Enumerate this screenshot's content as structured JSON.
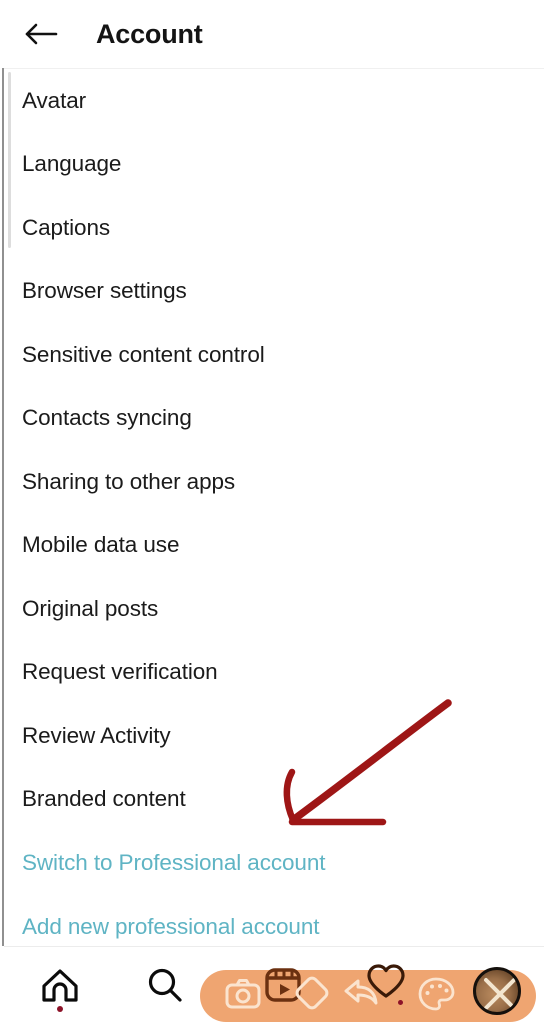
{
  "header": {
    "title": "Account",
    "back_icon": "arrow-left-icon"
  },
  "settings_list": {
    "items": [
      {
        "label": "Avatar",
        "type": "default"
      },
      {
        "label": "Language",
        "type": "default"
      },
      {
        "label": "Captions",
        "type": "default"
      },
      {
        "label": "Browser settings",
        "type": "default"
      },
      {
        "label": "Sensitive content control",
        "type": "default"
      },
      {
        "label": "Contacts syncing",
        "type": "default"
      },
      {
        "label": "Sharing to other apps",
        "type": "default"
      },
      {
        "label": "Mobile data use",
        "type": "default"
      },
      {
        "label": "Original posts",
        "type": "default"
      },
      {
        "label": "Request verification",
        "type": "default"
      },
      {
        "label": "Review Activity",
        "type": "default"
      },
      {
        "label": "Branded content",
        "type": "default"
      },
      {
        "label": "Switch to Professional account",
        "type": "link"
      },
      {
        "label": "Add new professional account",
        "type": "link"
      }
    ],
    "link_color": "#5fb4c4",
    "text_color": "#1b1b1b"
  },
  "annotation": {
    "shape": "hand-drawn-arrow",
    "color": "#9e1616",
    "points_at": "Switch to Professional account"
  },
  "bottom_nav": {
    "items": [
      {
        "name": "home-icon",
        "badge": "dot"
      },
      {
        "name": "search-icon",
        "badge": ""
      },
      {
        "name": "camera-icon",
        "badge": ""
      },
      {
        "name": "reels-icon",
        "badge": ""
      },
      {
        "name": "diamond-icon",
        "badge": ""
      },
      {
        "name": "share-icon",
        "badge": ""
      },
      {
        "name": "heart-icon",
        "badge": "dot"
      },
      {
        "name": "palette-icon",
        "badge": ""
      },
      {
        "name": "profile-avatar-icon",
        "badge": ""
      }
    ],
    "overlay": {
      "shape": "pill",
      "color": "#efa571"
    }
  }
}
